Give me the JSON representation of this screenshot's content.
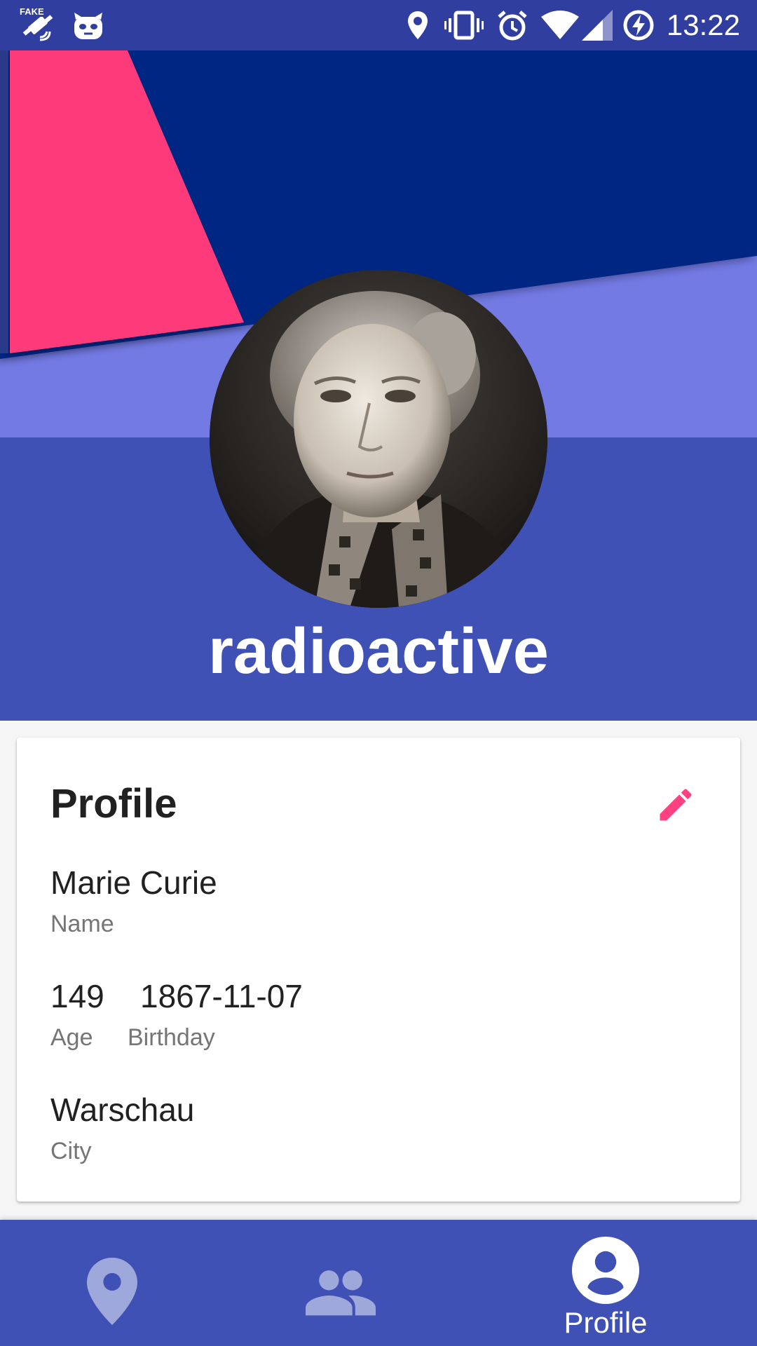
{
  "status_bar": {
    "time": "13:22",
    "icons": [
      "fake-gps-icon",
      "cyanogen-mascot-icon",
      "location-icon",
      "vibrate-icon",
      "alarm-icon",
      "wifi-icon",
      "cell-signal-icon",
      "battery-charging-icon"
    ],
    "fake_gps_text": "FAKE"
  },
  "header": {
    "username": "radioactive",
    "colors": {
      "dark_blue": "#002584",
      "pink": "#fe3a7a",
      "light_periwinkle": "#737ae4",
      "indigo": "#3f51b5"
    }
  },
  "profile_card": {
    "title": "Profile",
    "edit_icon": "pencil-icon",
    "name": {
      "value": "Marie Curie",
      "label": "Name"
    },
    "age": {
      "value": "149",
      "label": "Age"
    },
    "birthday": {
      "value": "1867-11-07",
      "label": "Birthday"
    },
    "city": {
      "value": "Warschau",
      "label": "City"
    }
  },
  "bottom_nav": {
    "items": [
      {
        "icon": "location-pin-icon",
        "label": "",
        "active": false
      },
      {
        "icon": "people-icon",
        "label": "",
        "active": false
      },
      {
        "icon": "account-circle-icon",
        "label": "Profile",
        "active": true
      }
    ]
  },
  "accent_colors": {
    "primary": "#3f51b5",
    "primary_dark": "#303f9f",
    "accent": "#ff4081"
  }
}
